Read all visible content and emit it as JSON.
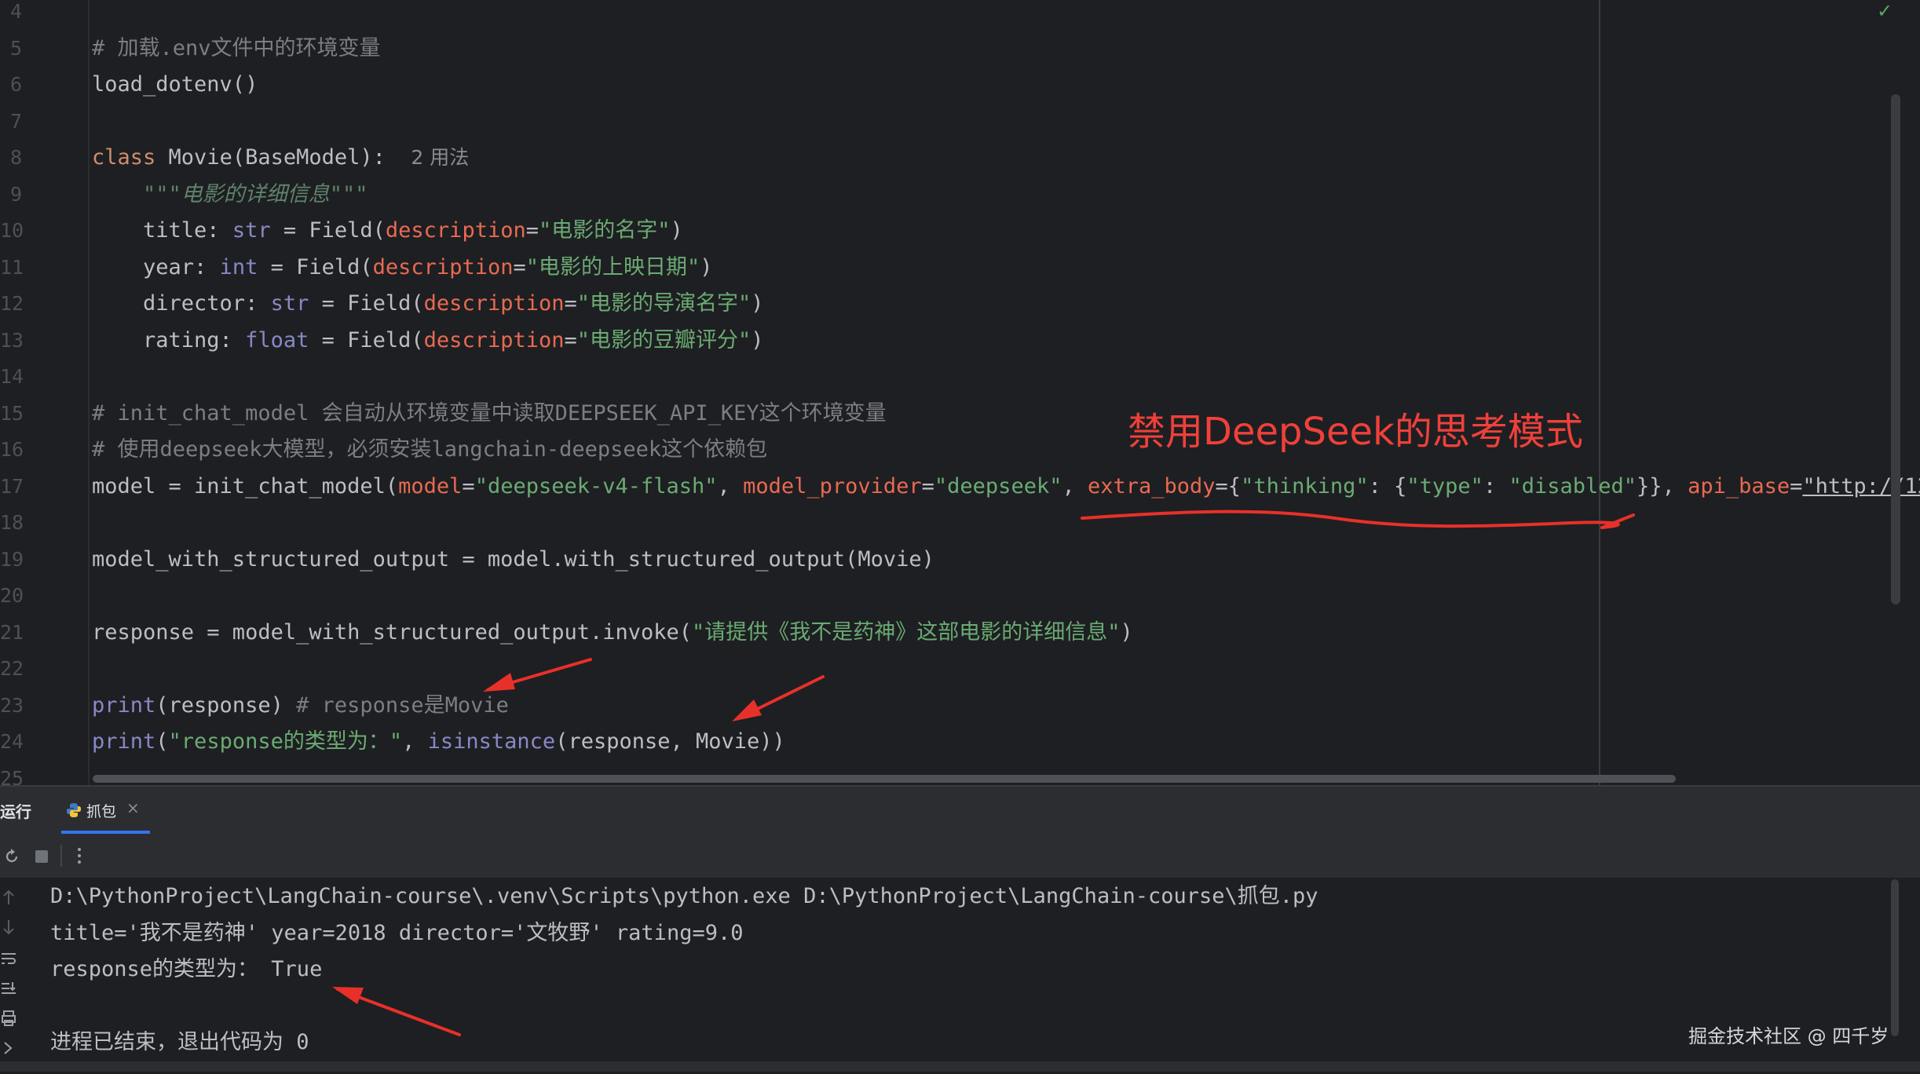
{
  "editor": {
    "lines": [
      {
        "n": "4",
        "segs": []
      },
      {
        "n": "5",
        "segs": [
          {
            "c": "cm",
            "t": "# 加载.env文件中的环境变量"
          }
        ]
      },
      {
        "n": "6",
        "segs": [
          {
            "c": "",
            "t": "load_dotenv()"
          }
        ]
      },
      {
        "n": "7",
        "segs": []
      },
      {
        "n": "8",
        "segs": [
          {
            "c": "kw",
            "t": "class "
          },
          {
            "c": "",
            "t": "Movie(BaseModel):  "
          },
          {
            "c": "hint",
            "t": "2 用法"
          }
        ]
      },
      {
        "n": "9",
        "segs": [
          {
            "c": "doc",
            "t": "    \"\"\"电影的详细信息\"\"\""
          }
        ]
      },
      {
        "n": "10",
        "segs": [
          {
            "c": "",
            "t": "    title: "
          },
          {
            "c": "bi",
            "t": "str"
          },
          {
            "c": "",
            "t": " = Field("
          },
          {
            "c": "prm",
            "t": "description"
          },
          {
            "c": "",
            "t": "="
          },
          {
            "c": "str",
            "t": "\"电影的名字\""
          },
          {
            "c": "",
            "t": ")"
          }
        ]
      },
      {
        "n": "11",
        "segs": [
          {
            "c": "",
            "t": "    year: "
          },
          {
            "c": "bi",
            "t": "int"
          },
          {
            "c": "",
            "t": " = Field("
          },
          {
            "c": "prm",
            "t": "description"
          },
          {
            "c": "",
            "t": "="
          },
          {
            "c": "str",
            "t": "\"电影的上映日期\""
          },
          {
            "c": "",
            "t": ")"
          }
        ]
      },
      {
        "n": "12",
        "segs": [
          {
            "c": "",
            "t": "    director: "
          },
          {
            "c": "bi",
            "t": "str"
          },
          {
            "c": "",
            "t": " = Field("
          },
          {
            "c": "prm",
            "t": "description"
          },
          {
            "c": "",
            "t": "="
          },
          {
            "c": "str",
            "t": "\"电影的导演名字\""
          },
          {
            "c": "",
            "t": ")"
          }
        ]
      },
      {
        "n": "13",
        "segs": [
          {
            "c": "",
            "t": "    rating: "
          },
          {
            "c": "bi",
            "t": "float"
          },
          {
            "c": "",
            "t": " = Field("
          },
          {
            "c": "prm",
            "t": "description"
          },
          {
            "c": "",
            "t": "="
          },
          {
            "c": "str",
            "t": "\"电影的豆瓣评分\""
          },
          {
            "c": "",
            "t": ")"
          }
        ]
      },
      {
        "n": "14",
        "segs": []
      },
      {
        "n": "15",
        "segs": [
          {
            "c": "cm",
            "t": "# init_chat_model 会自动从环境变量中读取DEEPSEEK_API_KEY这个环境变量"
          }
        ]
      },
      {
        "n": "16",
        "segs": [
          {
            "c": "cm",
            "t": "# 使用deepseek大模型，必须安装langchain-deepseek这个依赖包"
          }
        ]
      },
      {
        "n": "17",
        "segs": [
          {
            "c": "",
            "t": "model = init_chat_model("
          },
          {
            "c": "prm",
            "t": "model"
          },
          {
            "c": "",
            "t": "="
          },
          {
            "c": "str",
            "t": "\"deepseek-v4-flash\""
          },
          {
            "c": "",
            "t": ", "
          },
          {
            "c": "prm",
            "t": "model_provider"
          },
          {
            "c": "",
            "t": "="
          },
          {
            "c": "str",
            "t": "\"deepseek\""
          },
          {
            "c": "",
            "t": ", "
          },
          {
            "c": "prm",
            "t": "extra_body"
          },
          {
            "c": "",
            "t": "={"
          },
          {
            "c": "str",
            "t": "\"thinking\""
          },
          {
            "c": "",
            "t": ": {"
          },
          {
            "c": "str",
            "t": "\"type\""
          },
          {
            "c": "",
            "t": ": "
          },
          {
            "c": "str",
            "t": "\"disabled\""
          },
          {
            "c": "",
            "t": "}}, "
          },
          {
            "c": "prm",
            "t": "api_base"
          },
          {
            "c": "",
            "t": "="
          },
          {
            "c": "str url",
            "t": "\"http://12"
          }
        ]
      },
      {
        "n": "18",
        "segs": []
      },
      {
        "n": "19",
        "segs": [
          {
            "c": "",
            "t": "model_with_structured_output = model.with_structured_output(Movie)"
          }
        ]
      },
      {
        "n": "20",
        "segs": []
      },
      {
        "n": "21",
        "segs": [
          {
            "c": "",
            "t": "response = model_with_structured_output.invoke("
          },
          {
            "c": "str",
            "t": "\"请提供《我不是药神》这部电影的详细信息\""
          },
          {
            "c": "",
            "t": ")"
          }
        ]
      },
      {
        "n": "22",
        "segs": []
      },
      {
        "n": "23",
        "segs": [
          {
            "c": "bi",
            "t": "print"
          },
          {
            "c": "",
            "t": "(response) "
          },
          {
            "c": "cm",
            "t": "# response是Movie"
          }
        ]
      },
      {
        "n": "24",
        "segs": [
          {
            "c": "bi",
            "t": "print"
          },
          {
            "c": "",
            "t": "("
          },
          {
            "c": "str",
            "t": "\"response的类型为：\""
          },
          {
            "c": "",
            "t": ", "
          },
          {
            "c": "bi",
            "t": "isinstance"
          },
          {
            "c": "",
            "t": "(response, Movie))"
          }
        ]
      },
      {
        "n": "25",
        "segs": []
      }
    ]
  },
  "annotation": {
    "text": "禁用DeepSeek的思考模式",
    "color": "#f0403a"
  },
  "run_panel": {
    "title": "运行",
    "tab_label": "抓包",
    "tab_close": "×",
    "output": [
      "D:\\PythonProject\\LangChain-course\\.venv\\Scripts\\python.exe D:\\PythonProject\\LangChain-course\\抓包.py",
      "title='我不是药神' year=2018 director='文牧野' rating=9.0",
      "response的类型为： True",
      "",
      "进程已结束，退出代码为 0"
    ],
    "watermark": "掘金技术社区 @ 四千岁"
  },
  "icons": {
    "rerun": "rerun-icon",
    "stop": "stop-icon",
    "more": "more-icon",
    "check": "check-icon"
  },
  "colors": {
    "background": "#1e1f22",
    "keyword": "#cf8e6d",
    "string": "#6aab73",
    "param": "#e86a52",
    "builtin": "#8888c6",
    "comment": "#7a7e85",
    "accent": "#3574f0"
  }
}
